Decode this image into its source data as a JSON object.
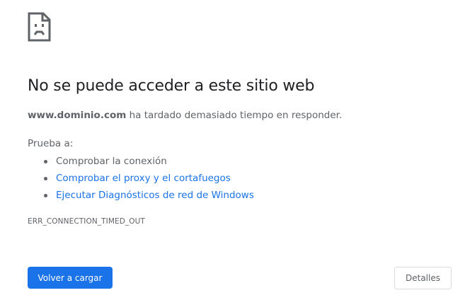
{
  "icon": {
    "name": "sad-page-icon"
  },
  "error": {
    "title": "No se puede acceder a este sitio web",
    "domain": "www.dominio.com",
    "summary_suffix": " ha tardado demasiado tiempo en responder.",
    "try_label": "Prueba a:",
    "suggestions": [
      {
        "label": "Comprobar la conexión",
        "is_link": false
      },
      {
        "label": "Comprobar el proxy y el cortafuegos",
        "is_link": true
      },
      {
        "label": "Ejecutar Diagnósticos de red de Windows",
        "is_link": true
      }
    ],
    "code": "ERR_CONNECTION_TIMED_OUT"
  },
  "buttons": {
    "reload_label": "Volver a cargar",
    "details_label": "Detalles"
  },
  "colors": {
    "accent": "#1a73e8",
    "text": "#202124",
    "secondary_text": "#5f6368",
    "border": "#dadce0"
  }
}
